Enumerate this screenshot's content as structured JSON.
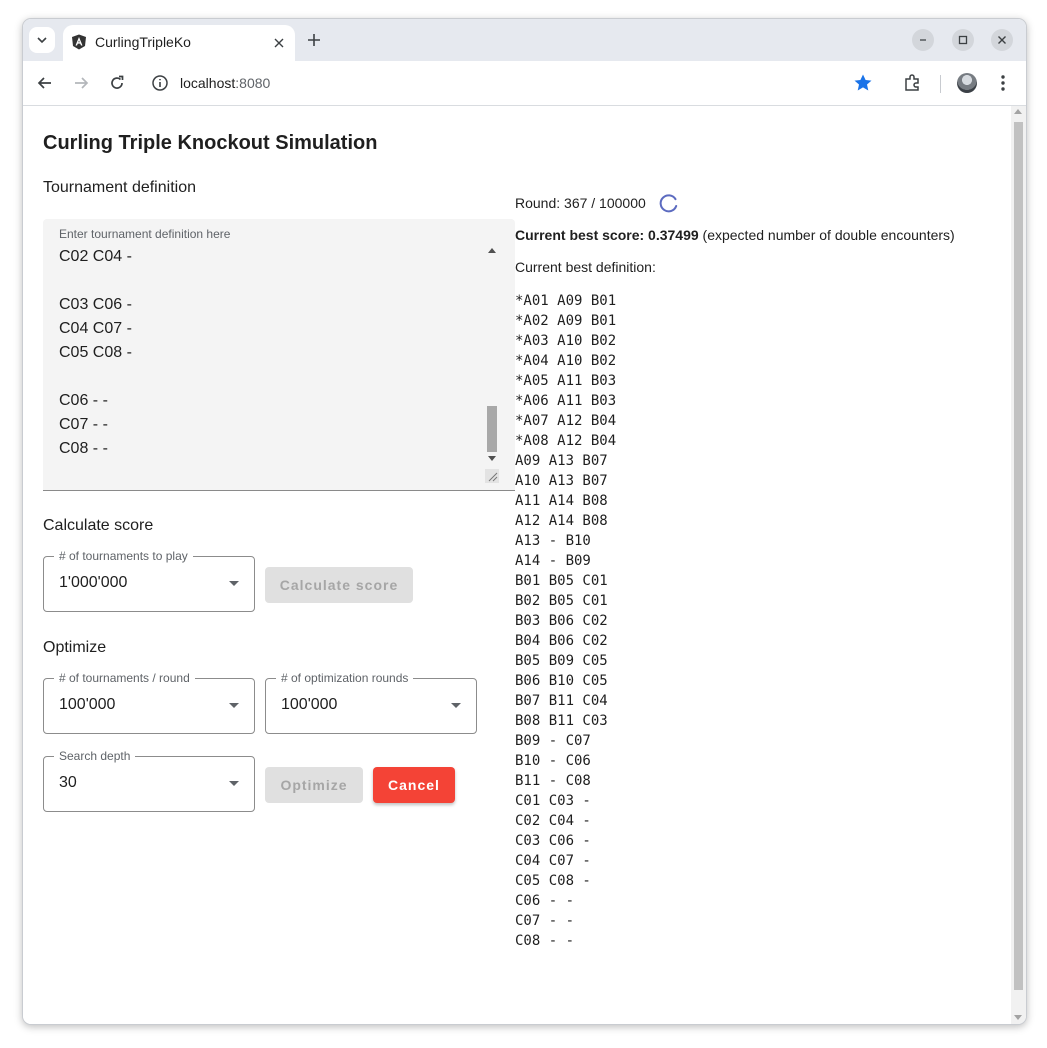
{
  "browser": {
    "tab_title": "CurlingTripleKo",
    "url_host": "localhost",
    "url_port": ":8080"
  },
  "app": {
    "title": "Curling Triple Knockout Simulation",
    "tournament_definition": {
      "heading": "Tournament definition",
      "placeholder": "Enter tournament definition here",
      "visible_lines": [
        "C02 C04 -",
        "",
        "C03 C06 -",
        "C04 C07 -",
        "C05 C08 -",
        "",
        "C06 - -",
        "C07 - -",
        "C08 - -"
      ]
    },
    "calculate": {
      "heading": "Calculate score",
      "tournaments_label": "# of tournaments to play",
      "tournaments_value": "1'000'000",
      "button_label": "Calculate score"
    },
    "optimize": {
      "heading": "Optimize",
      "per_round_label": "# of tournaments / round",
      "per_round_value": "100'000",
      "rounds_label": "# of optimization rounds",
      "rounds_value": "100'000",
      "depth_label": "Search depth",
      "depth_value": "30",
      "optimize_button": "Optimize",
      "cancel_button": "Cancel"
    },
    "status": {
      "round_text": "Round: 367 / 100000",
      "best_score_label": "Current best score: 0.37499",
      "best_score_note": " (expected number of double encounters)",
      "best_def_label": "Current best definition:",
      "definition_lines": [
        "*A01 A09 B01",
        "*A02 A09 B01",
        "*A03 A10 B02",
        "*A04 A10 B02",
        "*A05 A11 B03",
        "*A06 A11 B03",
        "*A07 A12 B04",
        "*A08 A12 B04",
        "A09 A13 B07",
        "A10 A13 B07",
        "A11 A14 B08",
        "A12 A14 B08",
        "A13 - B10",
        "A14 - B09",
        "B01 B05 C01",
        "B02 B05 C01",
        "B03 B06 C02",
        "B04 B06 C02",
        "B05 B09 C05",
        "B06 B10 C05",
        "B07 B11 C04",
        "B08 B11 C03",
        "B09 - C07",
        "B10 - C06",
        "B11 - C08",
        "C01 C03 -",
        "C02 C04 -",
        "C03 C06 -",
        "C04 C07 -",
        "C05 C08 -",
        "C06 - -",
        "C07 - -",
        "C08 - -"
      ]
    }
  },
  "colors": {
    "accent_cancel": "#f44336",
    "spinner": "#5c6bc0",
    "star": "#1a73e8"
  }
}
